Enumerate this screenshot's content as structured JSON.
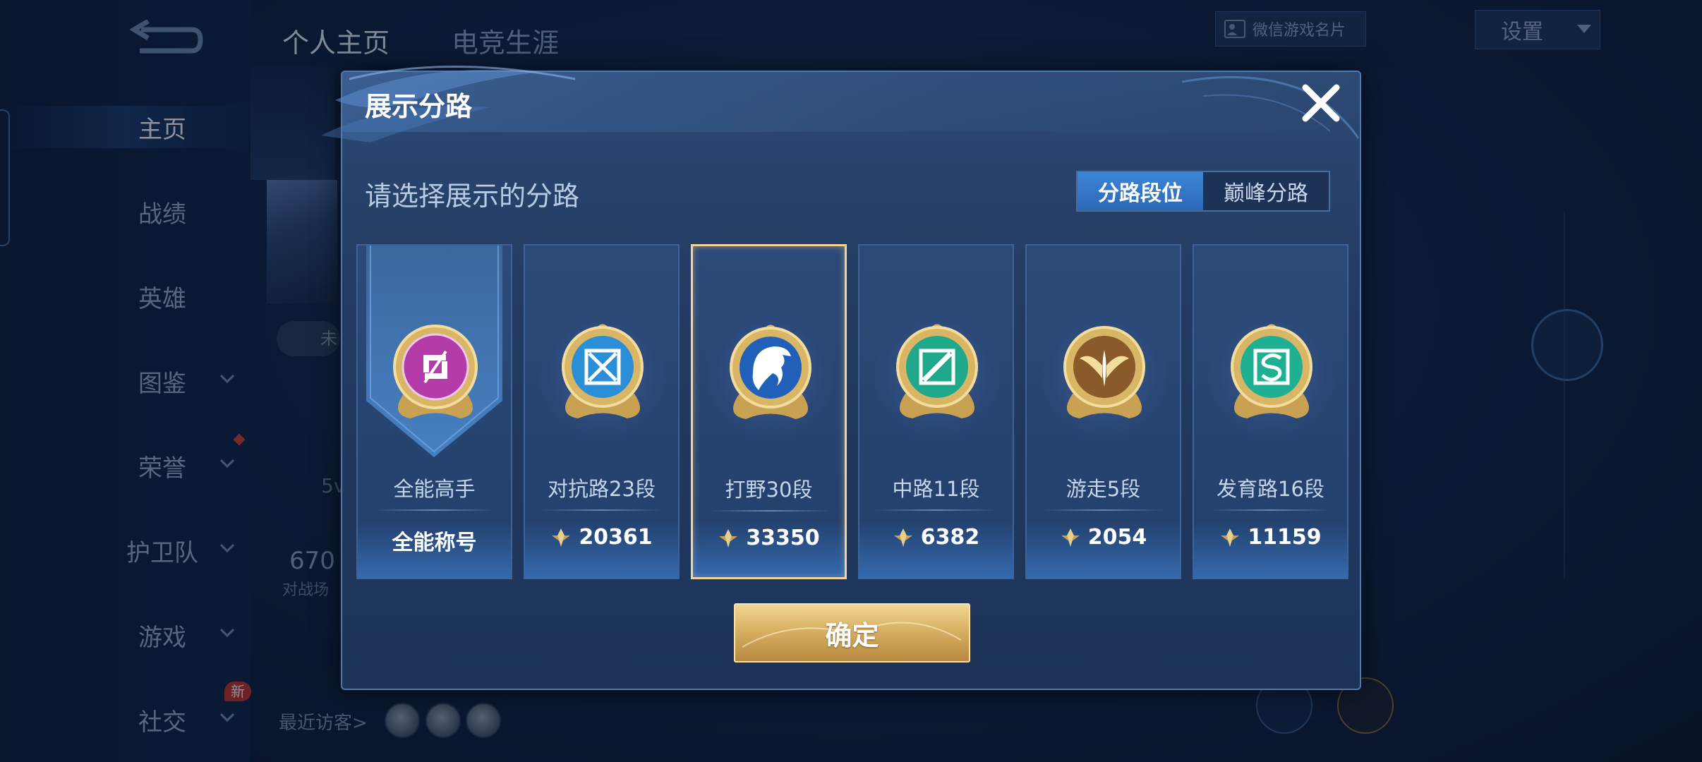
{
  "nav": {
    "items": [
      {
        "label": "主页",
        "active": true,
        "chevron": false
      },
      {
        "label": "战绩",
        "chevron": false
      },
      {
        "label": "英雄",
        "chevron": false
      },
      {
        "label": "图鉴",
        "chevron": true
      },
      {
        "label": "荣誉",
        "chevron": true
      },
      {
        "label": "护卫队",
        "chevron": true
      },
      {
        "label": "游戏",
        "chevron": true
      },
      {
        "label": "社交",
        "chevron": true
      }
    ],
    "new_badge": "新"
  },
  "top_tabs": [
    "个人主页",
    "电竞生涯"
  ],
  "wechat_card_label": "微信游戏名片",
  "settings_label": "设置",
  "background": {
    "status_badge": "未",
    "number": "670",
    "battle_label": "对战场",
    "fragment_5v": "5v",
    "recent_visitors": "最近访客>"
  },
  "modal": {
    "title": "展示分路",
    "prompt": "请选择展示的分路",
    "tabs": [
      {
        "label": "分路段位",
        "selected": true
      },
      {
        "label": "巅峰分路",
        "selected": false
      }
    ],
    "cards": [
      {
        "name": "全能高手",
        "value": "全能称号",
        "emblem": "all-round-emblem-icon",
        "selected": false,
        "has_points_icon": false
      },
      {
        "name": "对抗路23段",
        "value": "20361",
        "emblem": "clash-lane-emblem-icon",
        "selected": false,
        "has_points_icon": true
      },
      {
        "name": "打野30段",
        "value": "33350",
        "emblem": "jungle-dragon-emblem-icon",
        "selected": true,
        "has_points_icon": true
      },
      {
        "name": "中路11段",
        "value": "6382",
        "emblem": "mid-lane-emblem-icon",
        "selected": false,
        "has_points_icon": true
      },
      {
        "name": "游走5段",
        "value": "2054",
        "emblem": "roam-wings-emblem-icon",
        "selected": false,
        "has_points_icon": true
      },
      {
        "name": "发育路16段",
        "value": "11159",
        "emblem": "farm-lane-emblem-icon",
        "selected": false,
        "has_points_icon": true
      }
    ],
    "confirm_label": "确定"
  },
  "colors": {
    "accent_blue": "#2b68b6",
    "gold": "#d8b064",
    "selected_border": "#f3d39a"
  }
}
